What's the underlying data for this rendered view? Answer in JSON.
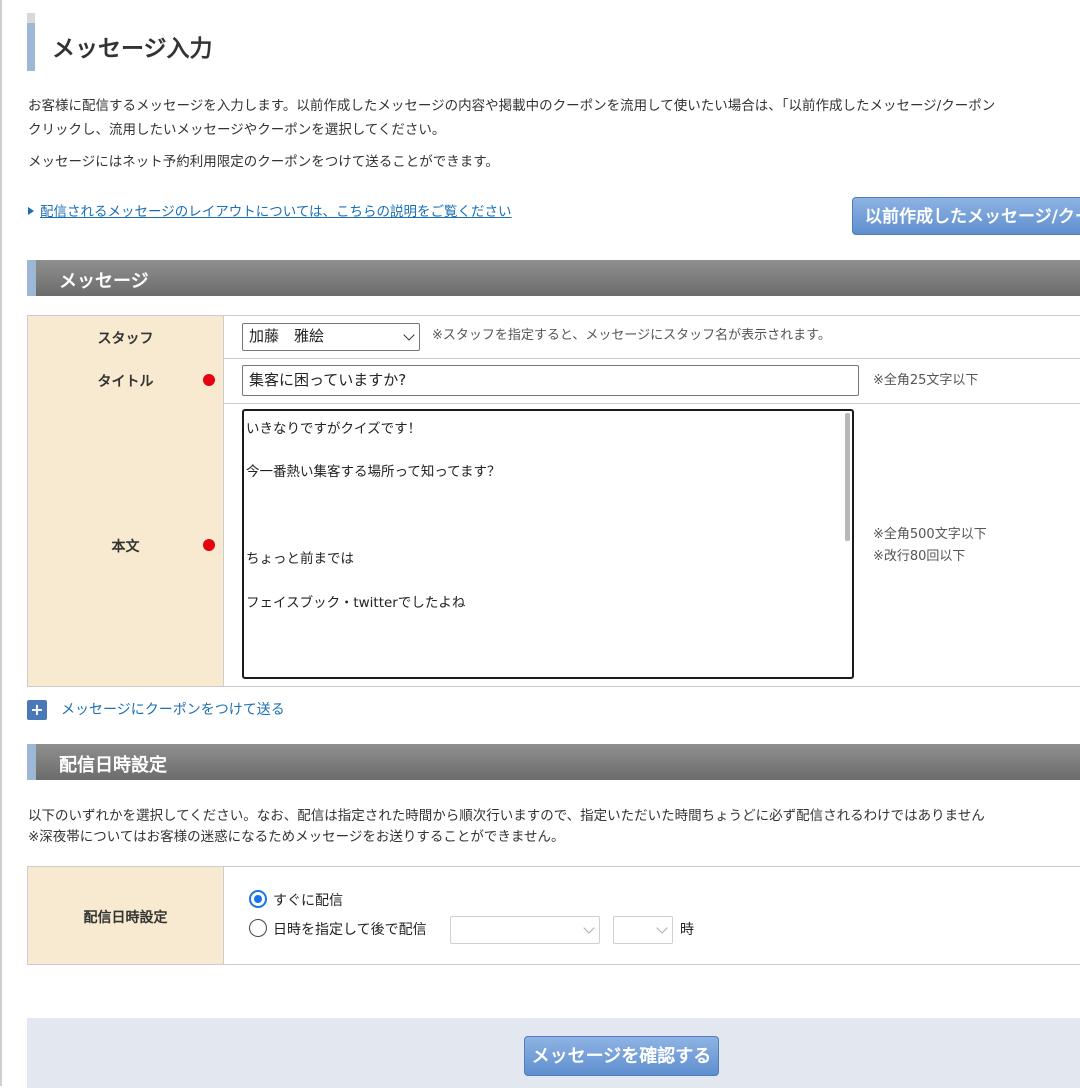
{
  "page": {
    "title": "メッセージ入力",
    "intro_line1": "お客様に配信するメッセージを入力します。以前作成したメッセージの内容や掲載中のクーポンを流用して使いたい場合は、「以前作成したメッセージ/クーポン",
    "intro_line2": "クリックし、流用したいメッセージやクーポンを選択してください。",
    "intro_line3": "メッセージにはネット予約利用限定のクーポンをつけて送ることができます。",
    "layout_link": "配信されるメッセージのレイアウトについては、こちらの説明をご覧ください",
    "prev_button": "以前作成したメッセージ/クーポン"
  },
  "message_section": {
    "heading": "メッセージ",
    "staff": {
      "label": "スタッフ",
      "selected": "加藤　雅絵",
      "note": "※スタッフを指定すると、メッセージにスタッフ名が表示されます。"
    },
    "title_field": {
      "label": "タイトル",
      "value": "集客に困っていますか?",
      "note": "※全角25文字以下"
    },
    "body_field": {
      "label": "本文",
      "lines": [
        "いきなりですがクイズです！",
        "今一番熱い集客する場所って知ってます？",
        "ちょっと前までは",
        "フェイスブック・twitterでしたよね"
      ],
      "note1": "※全角500文字以下",
      "note2": "※改行80回以下"
    },
    "coupon_link": "メッセージにクーポンをつけて送る"
  },
  "schedule_section": {
    "heading": "配信日時設定",
    "desc1": "以下のいずれかを選択してください。なお、配信は指定された時間から順次行いますので、指定いただいた時間ちょうどに必ず配信されるわけではありません",
    "desc2": "※深夜帯についてはお客様の迷惑になるためメッセージをお送りすることができません。",
    "label": "配信日時設定",
    "option_now": "すぐに配信",
    "option_later": "日時を指定して後で配信",
    "hour_unit": "時"
  },
  "footer": {
    "confirm_button": "メッセージを確認する"
  },
  "colors": {
    "accent": "#5f8fcf",
    "link": "#1a6fb5",
    "header_cell": "#f7ead0",
    "required": "#e60012"
  }
}
